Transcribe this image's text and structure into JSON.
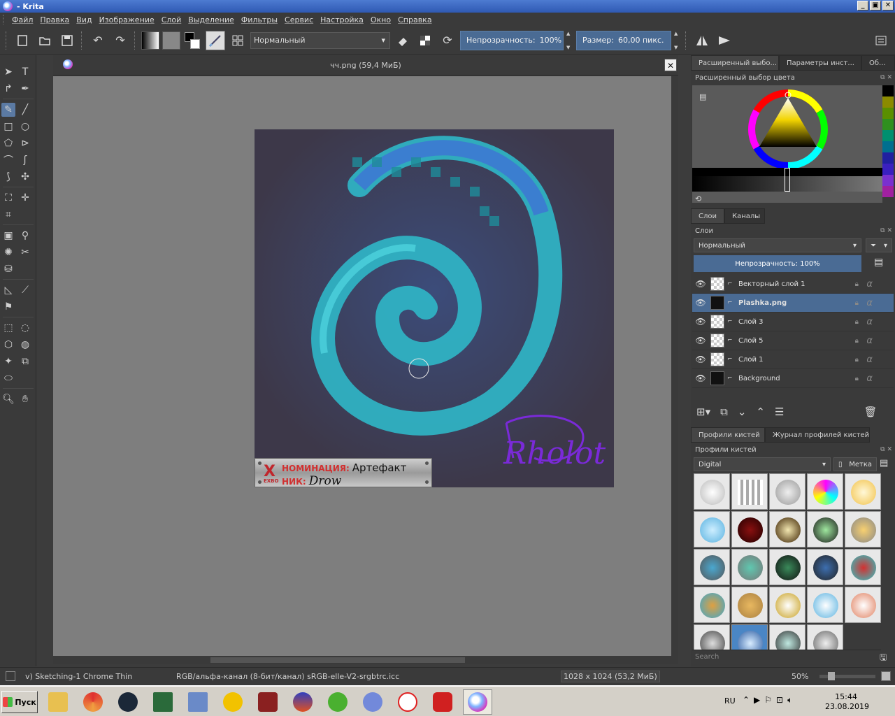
{
  "window": {
    "title": " - Krita",
    "buttons": [
      "_",
      "▣",
      "✕"
    ]
  },
  "menu": [
    "Файл",
    "Правка",
    "Вид",
    "Изображение",
    "Слой",
    "Выделение",
    "Фильтры",
    "Сервис",
    "Настройка",
    "Окно",
    "Справка"
  ],
  "toolbar": {
    "blend_mode": "Нормальный",
    "opacity_label": "Непрозрачность:",
    "opacity_value": "100%",
    "size_label": "Размер:",
    "size_value": "60,00 пикс."
  },
  "document": {
    "tab_title": "чч.png (59,4 МиБ)",
    "close_label": "✕"
  },
  "plaque": {
    "nomination_label": "НОМИНАЦИЯ:",
    "nomination_value": "Артефакт",
    "nick_label": "НИК:",
    "nick_value": "Drow",
    "logo": "X",
    "logo_sub": "EXBO"
  },
  "signature": "Rholot",
  "dock": {
    "top_tabs": [
      "Расширенный выбо...",
      "Параметры инст...",
      "Об..."
    ],
    "color_panel_title": "Расширенный выбор цвета",
    "swatches": [
      "#000000",
      "#8b8b00",
      "#5a8f00",
      "#2f8f1f",
      "#008f6f",
      "#006f8f",
      "#2020a0",
      "#3a20c0",
      "#7a30d0",
      "#a020a0"
    ],
    "layers_tabs": [
      "Слои",
      "Каналы"
    ],
    "layers_title": "Слои",
    "layers_blend": "Нормальный",
    "layers_opacity": "Непрозрачность:  100%",
    "layers": [
      {
        "name": "Векторный слой 1",
        "selected": false,
        "bold": false,
        "dark": false
      },
      {
        "name": "Plashka.png",
        "selected": true,
        "bold": true,
        "dark": true
      },
      {
        "name": "Слой 3",
        "selected": false,
        "bold": false,
        "dark": false
      },
      {
        "name": "Слой 5",
        "selected": false,
        "bold": false,
        "dark": false
      },
      {
        "name": "Слой 1",
        "selected": false,
        "bold": false,
        "dark": false
      },
      {
        "name": "Background",
        "selected": false,
        "bold": false,
        "dark": true
      }
    ],
    "brush_tabs": [
      "Профили кистей",
      "Журнал профилей кистей"
    ],
    "brush_title": "Профили кистей",
    "brush_tag": "Digital",
    "brush_tag_label": "Метка",
    "search_placeholder": "Search"
  },
  "status": {
    "brush": "v) Sketching-1 Chrome Thin",
    "color": "RGB/альфа-канал (8-бит/канал)  sRGB-elle-V2-srgbtrc.icc",
    "dimensions": "1028 x 1024 (53,2 МиБ)",
    "zoom": "50%"
  },
  "taskbar": {
    "start": "Пуск",
    "lang": "RU",
    "time": "15:44",
    "date": "23.08.2019"
  }
}
